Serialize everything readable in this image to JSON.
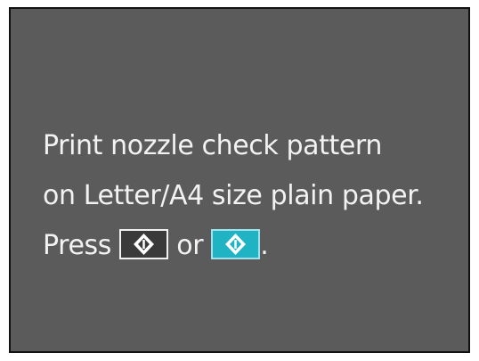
{
  "screen": {
    "line1": "Print nozzle check pattern",
    "line2": "on Letter/A4 size plain paper.",
    "line3_prefix": "Press",
    "line3_or": "or",
    "line3_suffix": ".",
    "buttons": {
      "bw_start_icon": "start-diamond-icon",
      "color_start_icon": "start-diamond-icon"
    },
    "colors": {
      "screen_bg": "#5b5b5b",
      "text": "#f2f2f2",
      "color_button": "#1fb3c4",
      "bw_button": "#3a3a3a"
    }
  }
}
